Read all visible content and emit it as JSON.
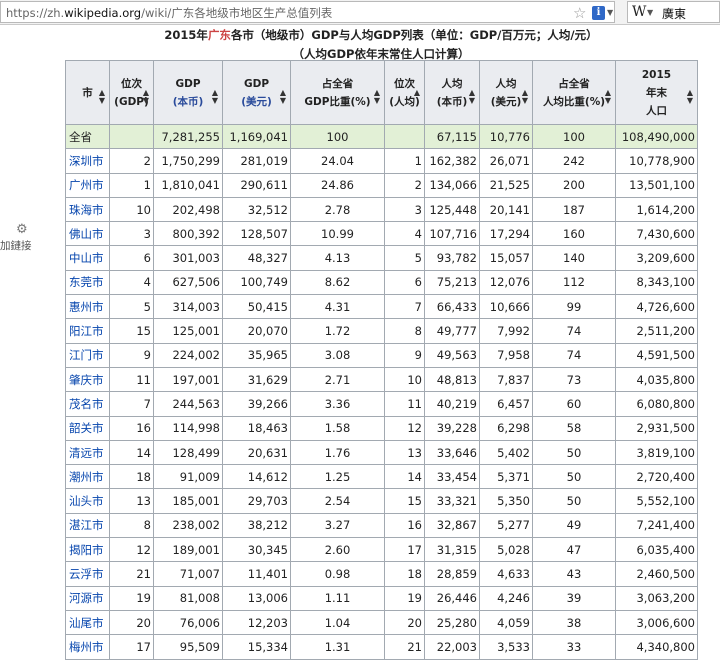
{
  "browser": {
    "url_prefix": "https://zh.",
    "url_domain": "wikipedia.org",
    "url_path": "/wiki/广东各地级市地区生产总值列表",
    "search_engine_label": "W",
    "search_text": "廣東"
  },
  "sidebar": {
    "text": "加鏈接"
  },
  "caption": {
    "part1": "2015年",
    "part2": "广东",
    "part3": "各市（地级市）GDP与人均GDP列表（单位：GDP/百万元；人均/元）",
    "line2": "（人均GDP依年末常住人口计算）"
  },
  "headers": {
    "city": "市",
    "rank_gdp_1": "位次",
    "rank_gdp_2": "(GDP)",
    "gdp_local_1": "GDP",
    "gdp_local_2": "(本币)",
    "gdp_usd_1": "GDP",
    "gdp_usd_2": "(美元)",
    "share_gdp_1": "占全省",
    "share_gdp_2": "GDP比重(%)",
    "rank_pc_1": "位次",
    "rank_pc_2": "(人均)",
    "pc_local_1": "人均",
    "pc_local_2": "(本币)",
    "pc_usd_1": "人均",
    "pc_usd_2": "(美元)",
    "share_pc_1": "占全省",
    "share_pc_2": "人均比重(%)",
    "pop_1": "2015",
    "pop_2": "年末",
    "pop_3": "人口"
  },
  "total_row": [
    "全省",
    "",
    "7,281,255",
    "1,169,041",
    "100",
    "",
    "67,115",
    "10,776",
    "100",
    "108,490,000"
  ],
  "rows": [
    [
      "深圳市",
      "2",
      "1,750,299",
      "281,019",
      "24.04",
      "1",
      "162,382",
      "26,071",
      "242",
      "10,778,900"
    ],
    [
      "广州市",
      "1",
      "1,810,041",
      "290,611",
      "24.86",
      "2",
      "134,066",
      "21,525",
      "200",
      "13,501,100"
    ],
    [
      "珠海市",
      "10",
      "202,498",
      "32,512",
      "2.78",
      "3",
      "125,448",
      "20,141",
      "187",
      "1,614,200"
    ],
    [
      "佛山市",
      "3",
      "800,392",
      "128,507",
      "10.99",
      "4",
      "107,716",
      "17,294",
      "160",
      "7,430,600"
    ],
    [
      "中山市",
      "6",
      "301,003",
      "48,327",
      "4.13",
      "5",
      "93,782",
      "15,057",
      "140",
      "3,209,600"
    ],
    [
      "东莞市",
      "4",
      "627,506",
      "100,749",
      "8.62",
      "6",
      "75,213",
      "12,076",
      "112",
      "8,343,100"
    ],
    [
      "惠州市",
      "5",
      "314,003",
      "50,415",
      "4.31",
      "7",
      "66,433",
      "10,666",
      "99",
      "4,726,600"
    ],
    [
      "阳江市",
      "15",
      "125,001",
      "20,070",
      "1.72",
      "8",
      "49,777",
      "7,992",
      "74",
      "2,511,200"
    ],
    [
      "江门市",
      "9",
      "224,002",
      "35,965",
      "3.08",
      "9",
      "49,563",
      "7,958",
      "74",
      "4,591,500"
    ],
    [
      "肇庆市",
      "11",
      "197,001",
      "31,629",
      "2.71",
      "10",
      "48,813",
      "7,837",
      "73",
      "4,035,800"
    ],
    [
      "茂名市",
      "7",
      "244,563",
      "39,266",
      "3.36",
      "11",
      "40,219",
      "6,457",
      "60",
      "6,080,800"
    ],
    [
      "韶关市",
      "16",
      "114,998",
      "18,463",
      "1.58",
      "12",
      "39,228",
      "6,298",
      "58",
      "2,931,500"
    ],
    [
      "清远市",
      "14",
      "128,499",
      "20,631",
      "1.76",
      "13",
      "33,646",
      "5,402",
      "50",
      "3,819,100"
    ],
    [
      "潮州市",
      "18",
      "91,009",
      "14,612",
      "1.25",
      "14",
      "33,454",
      "5,371",
      "50",
      "2,720,400"
    ],
    [
      "汕头市",
      "13",
      "185,001",
      "29,703",
      "2.54",
      "15",
      "33,321",
      "5,350",
      "50",
      "5,552,100"
    ],
    [
      "湛江市",
      "8",
      "238,002",
      "38,212",
      "3.27",
      "16",
      "32,867",
      "5,277",
      "49",
      "7,241,400"
    ],
    [
      "揭阳市",
      "12",
      "189,001",
      "30,345",
      "2.60",
      "17",
      "31,315",
      "5,028",
      "47",
      "6,035,400"
    ],
    [
      "云浮市",
      "21",
      "71,007",
      "11,401",
      "0.98",
      "18",
      "28,859",
      "4,633",
      "43",
      "2,460,500"
    ],
    [
      "河源市",
      "19",
      "81,008",
      "13,006",
      "1.11",
      "19",
      "26,446",
      "4,246",
      "39",
      "3,063,200"
    ],
    [
      "汕尾市",
      "20",
      "76,006",
      "12,203",
      "1.04",
      "20",
      "25,280",
      "4,059",
      "38",
      "3,006,600"
    ],
    [
      "梅州市",
      "17",
      "95,509",
      "15,334",
      "1.31",
      "21",
      "22,003",
      "3,533",
      "33",
      "4,340,800"
    ]
  ]
}
